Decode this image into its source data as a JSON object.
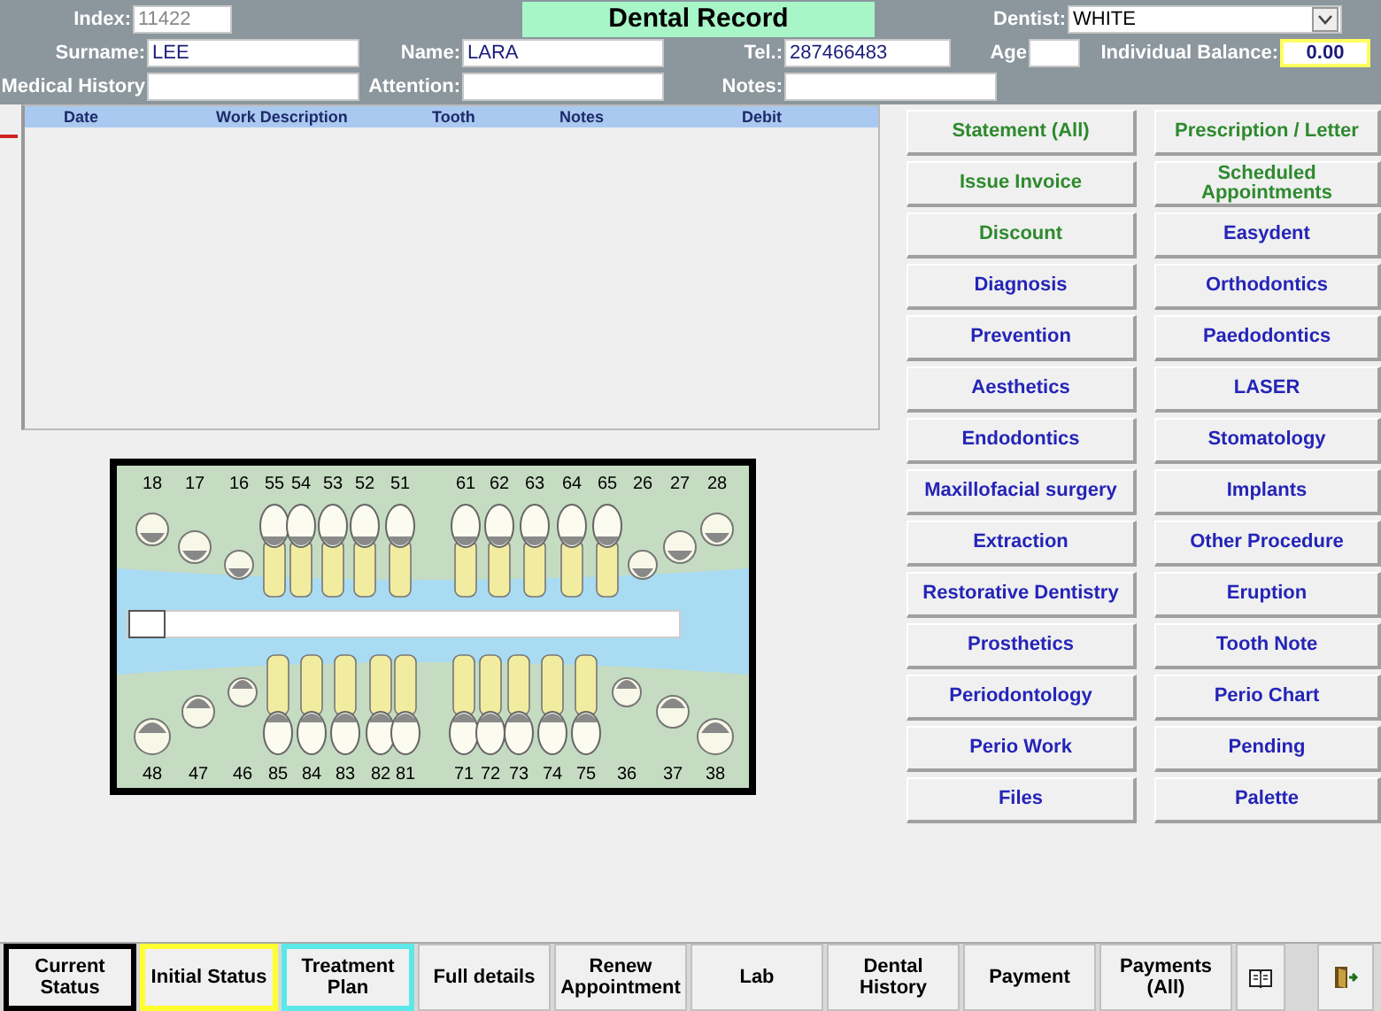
{
  "header": {
    "title": "Dental Record",
    "index": {
      "label": "Index:",
      "value": "11422",
      "disabled": true
    },
    "dentist": {
      "label": "Dentist:",
      "value": "WHITE"
    },
    "surname": {
      "label": "Surname:",
      "value": "LEE"
    },
    "name": {
      "label": "Name:",
      "value": "LARA"
    },
    "tel": {
      "label": "Tel.:",
      "value": "287466483"
    },
    "age": {
      "label": "Age"
    },
    "balance": {
      "label": "Individual Balance:",
      "value": "0.00"
    },
    "medical_history": {
      "label": "Medical History"
    },
    "attention": {
      "label": "Attention:"
    },
    "notes": {
      "label": "Notes:"
    }
  },
  "table": {
    "columns": [
      "Date",
      "Work Description",
      "Tooth",
      "Notes",
      "Debit"
    ]
  },
  "tooth_chart": {
    "upper_numbers": [
      "18",
      "17",
      "16",
      "55",
      "54",
      "53",
      "52",
      "51",
      "61",
      "62",
      "63",
      "64",
      "65",
      "26",
      "27",
      "28"
    ],
    "lower_numbers": [
      "48",
      "47",
      "46",
      "85",
      "84",
      "83",
      "82",
      "81",
      "71",
      "72",
      "73",
      "74",
      "75",
      "36",
      "37",
      "38"
    ]
  },
  "action_buttons": [
    {
      "label": "Statement (All)",
      "kind": "finance"
    },
    {
      "label": "Prescription / Letter",
      "kind": "finance"
    },
    {
      "label": "Issue Invoice",
      "kind": "finance"
    },
    {
      "label": "Scheduled Appointments",
      "kind": "finance"
    },
    {
      "label": "Discount",
      "kind": "finance"
    },
    {
      "label": "Easydent",
      "kind": "clinical"
    },
    {
      "label": "Diagnosis",
      "kind": "clinical"
    },
    {
      "label": "Orthodontics",
      "kind": "clinical"
    },
    {
      "label": "Prevention",
      "kind": "clinical"
    },
    {
      "label": "Paedodontics",
      "kind": "clinical"
    },
    {
      "label": "Aesthetics",
      "kind": "clinical"
    },
    {
      "label": "LASER",
      "kind": "clinical"
    },
    {
      "label": "Endodontics",
      "kind": "clinical"
    },
    {
      "label": "Stomatology",
      "kind": "clinical"
    },
    {
      "label": "Maxillofacial surgery",
      "kind": "clinical"
    },
    {
      "label": "Implants",
      "kind": "clinical"
    },
    {
      "label": "Extraction",
      "kind": "clinical"
    },
    {
      "label": "Other Procedure",
      "kind": "clinical"
    },
    {
      "label": "Restorative Dentistry",
      "kind": "clinical"
    },
    {
      "label": "Eruption",
      "kind": "clinical"
    },
    {
      "label": "Prosthetics",
      "kind": "clinical"
    },
    {
      "label": "Tooth Note",
      "kind": "clinical"
    },
    {
      "label": "Periodontology",
      "kind": "clinical"
    },
    {
      "label": "Perio Chart",
      "kind": "clinical"
    },
    {
      "label": "Perio Work",
      "kind": "clinical"
    },
    {
      "label": "Pending",
      "kind": "clinical"
    },
    {
      "label": "Files",
      "kind": "clinical"
    },
    {
      "label": "Palette",
      "kind": "clinical"
    }
  ],
  "bottom_tabs": [
    {
      "label": "Current Status",
      "kind": "current",
      "selected": true
    },
    {
      "label": "Initial Status",
      "kind": "initial",
      "selected": false
    },
    {
      "label": "Treatment Plan",
      "kind": "plan",
      "selected": false
    },
    {
      "label": "Full details",
      "kind": "plain",
      "selected": false
    },
    {
      "label": "Renew Appointment",
      "kind": "plain",
      "selected": false
    },
    {
      "label": "Lab",
      "kind": "plain",
      "selected": false
    },
    {
      "label": "Dental History",
      "kind": "plain",
      "selected": false
    },
    {
      "label": "Payment",
      "kind": "plain",
      "selected": false
    },
    {
      "label": "Payments (All)",
      "kind": "plain",
      "selected": false
    },
    {
      "kind": "book"
    },
    {
      "kind": "exit"
    }
  ]
}
